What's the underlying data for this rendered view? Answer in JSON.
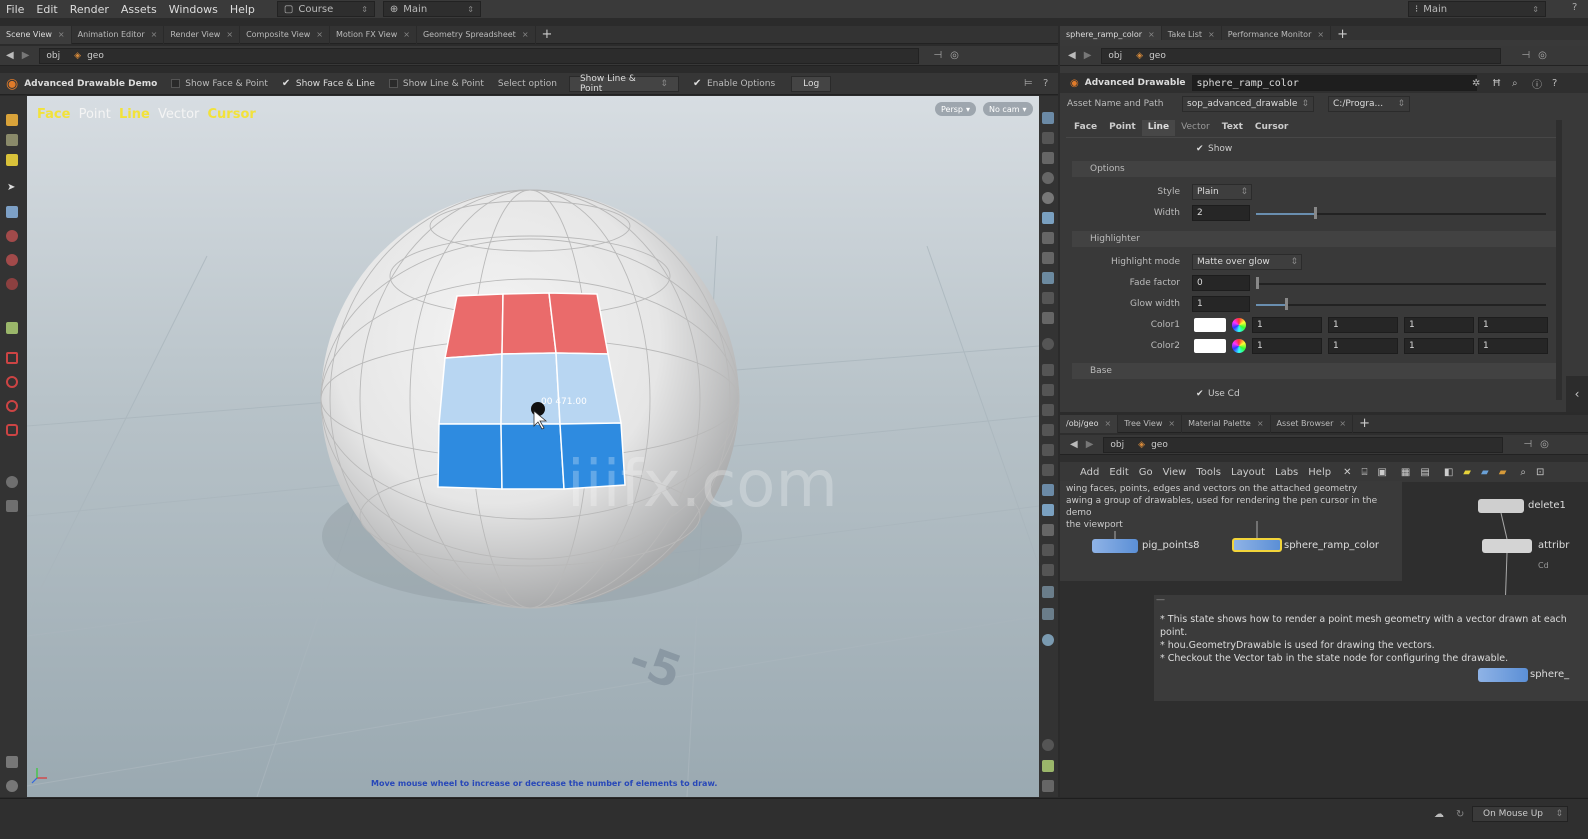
{
  "menubar": {
    "items": [
      "File",
      "Edit",
      "Render",
      "Assets",
      "Windows",
      "Help"
    ],
    "desktop": "Course",
    "context": "Main",
    "right_context": "Main"
  },
  "left_tabs": [
    "Scene View",
    "Animation Editor",
    "Render View",
    "Composite View",
    "Motion FX View",
    "Geometry Spreadsheet"
  ],
  "right_tabs": [
    "sphere_ramp_color",
    "Take List",
    "Performance Monitor"
  ],
  "path": {
    "obj": "obj",
    "geo": "geo"
  },
  "viewer_toolbar": {
    "title": "Advanced Drawable Demo",
    "show_face_point": "Show Face & Point",
    "show_face_line": "Show Face & Line",
    "show_line_point": "Show Line & Point",
    "select_option": "Select option",
    "select_value": "Show Line & Point",
    "enable_options": "Enable Options",
    "log": "Log"
  },
  "viewport": {
    "hud": [
      "Face",
      "Point",
      "Line",
      "Vector",
      "Cursor"
    ],
    "persp": "Persp",
    "cam": "No cam",
    "cursor_readout": "00 471.00",
    "grid_label": "-5",
    "hint": "Move mouse wheel to increase or decrease the number of elements to draw.",
    "watermark": "iiifx.com",
    "face_colors": {
      "top": "#ea6b6b",
      "mid": "#b8d6f2",
      "bottom": "#2e8be0"
    }
  },
  "params": {
    "type": "Advanced Drawable",
    "node": "sphere_ramp_color",
    "asset_label": "Asset Name and Path",
    "asset_name": "sop_advanced_drawable",
    "asset_path": "C:/Progra...",
    "tabs": [
      "Face",
      "Point",
      "Line",
      "Vector",
      "Text",
      "Cursor"
    ],
    "show": "Show",
    "options_section": "Options",
    "style_label": "Style",
    "style_value": "Plain",
    "width_label": "Width",
    "width_value": "2",
    "width_frac": 0.2,
    "highlighter_section": "Highlighter",
    "highlight_mode_label": "Highlight mode",
    "highlight_mode_value": "Matte over glow",
    "fade_label": "Fade factor",
    "fade_value": "0",
    "fade_frac": 0.0,
    "glow_label": "Glow width",
    "glow_value": "1",
    "glow_frac": 0.1,
    "color1_label": "Color1",
    "color1": [
      "1",
      "1",
      "1",
      "1"
    ],
    "color2_label": "Color2",
    "color2": [
      "1",
      "1",
      "1",
      "1"
    ],
    "base_section": "Base",
    "use_cd": "Use Cd"
  },
  "network": {
    "tabs": [
      "/obj/geo",
      "Tree View",
      "Material Palette",
      "Asset Browser"
    ],
    "menu": [
      "Add",
      "Edit",
      "Go",
      "View",
      "Tools",
      "Layout",
      "Labs",
      "Help"
    ],
    "desc_lines": [
      "wing faces, points, edges and vectors on the attached geometry",
      "awing a group of drawables, used for rendering the pen cursor in the demo",
      "the viewport"
    ],
    "nodes": [
      "pig_points8",
      "sphere_ramp_color",
      "delete1",
      "attribr",
      "sphere_"
    ],
    "node_sub": "Cd",
    "note_lines": [
      "* This state shows how to render a point mesh geometry with a vector drawn at each point.",
      "* hou.GeometryDrawable is used for drawing the vectors.",
      "* Checkout the Vector tab in the state node for configuring the drawable."
    ]
  },
  "status": {
    "mode": "On Mouse Up"
  }
}
